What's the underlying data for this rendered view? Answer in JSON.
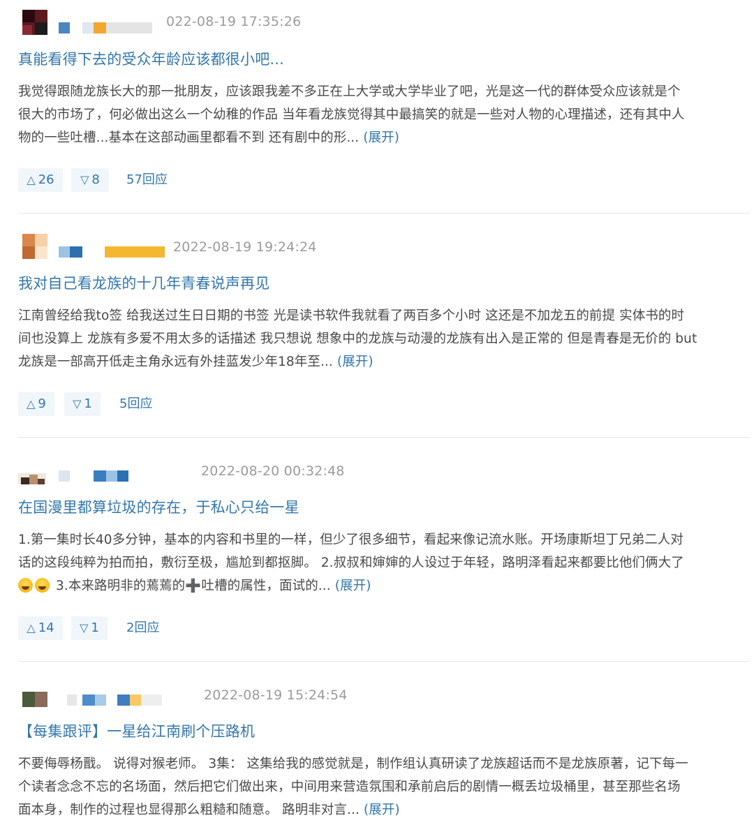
{
  "colors": {
    "link": "#3377aa",
    "body_text": "#494949",
    "meta": "#9b9b9b",
    "button_bg": "#f0f6fa",
    "divider": "#e8e8e8"
  },
  "reviews": [
    {
      "timestamp": "022-08-19 17:35:26",
      "title": "真能看得下去的受众年龄应该都很小吧...",
      "body_lines": [
        "我觉得跟随龙族长大的那一批朋友，应该跟我差不多正在上大学或大学毕业了吧，光是这一代的群体受众应该就是个",
        "很大的市场了，何必做出这么一个幼稚的作品 当年看龙族觉得其中最搞笑的就是一些对人物的心理描述，还有其中人",
        "物的一些吐槽...基本在这部动画里都看不到 还有剧中的形... "
      ],
      "expand_label": "(展开)",
      "upvote_icon": "△",
      "upvotes": "26",
      "downvote_icon": "▽",
      "downvotes": "8",
      "replies": "57回应"
    },
    {
      "timestamp": "2022-08-19 19:24:24",
      "title": "我对自己看龙族的十几年青春说声再见",
      "body_lines": [
        "江南曾经给我to签 给我送过生日日期的书签 光是读书软件我就看了两百多个小时 这还是不加龙五的前提 实体书的时",
        "间也没算上 龙族有多爱不用太多的话描述 我只想说 想象中的龙族与动漫的龙族有出入是正常的 但是青春是无价的 but",
        "龙族是一部高开低走主角永远有外挂蓝发少年18年至... "
      ],
      "expand_label": "(展开)",
      "upvote_icon": "△",
      "upvotes": "9",
      "downvote_icon": "▽",
      "downvotes": "1",
      "replies": "5回应"
    },
    {
      "timestamp": "2022-08-20 00:32:48",
      "title": "在国漫里都算垃圾的存在，于私心只给一星",
      "body_lines": [
        "1.第一集时长40多分钟，基本的内容和书里的一样，但少了很多细节，看起来像记流水账。开场康斯坦丁兄弟二人对",
        "话的这段纯粹为拍而拍，敷衍至极，尴尬到都抠脚。 2.叔叔和婶婶的人设过于年轻，路明泽看起来都要比他们俩大了",
        "3.本来路明非的蔫蔫的",
        "吐槽的属性，面试的... "
      ],
      "cross_glyph": "➕",
      "emoji_name": "grinning-sweat-emoji",
      "expand_label": "(展开)",
      "upvote_icon": "△",
      "upvotes": "14",
      "downvote_icon": "▽",
      "downvotes": "1",
      "replies": "2回应"
    },
    {
      "timestamp": "2022-08-19 15:24:54",
      "title": "【每集跟评】一星给江南刷个压路机",
      "body_lines": [
        "不要侮辱杨戬。 说得对猴老师。 3集： 这集给我的感觉就是，制作组认真研读了龙族超话而不是龙族原著，记下每一",
        "个读者念念不忘的名场面，然后把它们做出来，中间用来营造氛围和承前启后的剧情一概丢垃圾桶里，甚至那些名场",
        "面本身，制作的过程也显得那么粗糙和随意。 路明非对言... "
      ],
      "expand_label": "(展开)"
    }
  ]
}
